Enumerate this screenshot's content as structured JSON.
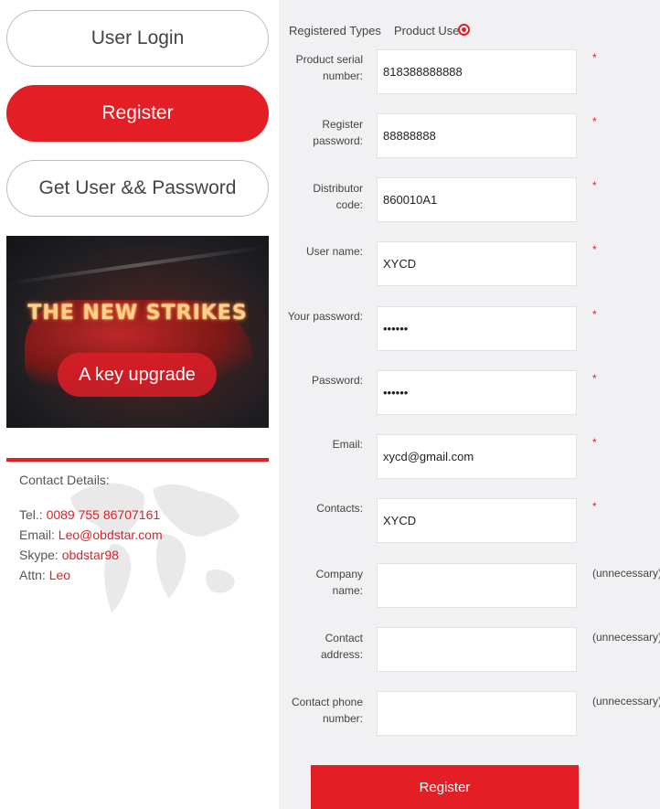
{
  "nav": {
    "user_login": "User Login",
    "register": "Register",
    "get_user_password": "Get User && Password"
  },
  "banner": {
    "headline": "THE NEW STRIKES",
    "tagline": "A key upgrade"
  },
  "contact": {
    "title": "Contact Details:",
    "tel_label": "Tel.:",
    "tel_value": "0089 755 86707161",
    "email_label": "Email:",
    "email_value": "Leo@obdstar.com",
    "skype_label": "Skype:",
    "skype_value": "obdstar98",
    "attn_label": "Attn:",
    "attn_value": "Leo"
  },
  "form": {
    "registered_types_label": "Registered Types",
    "product_user_label": "Product User",
    "product_user_selected": true,
    "fields": [
      {
        "label_line1": "Product serial",
        "label_line2": "number:",
        "value": "818388888888",
        "required_mark": "*",
        "optional_note": ""
      },
      {
        "label_line1": "Register",
        "label_line2": "password:",
        "value": "88888888",
        "required_mark": "*",
        "optional_note": ""
      },
      {
        "label_line1": "Distributor",
        "label_line2": "code:",
        "value": "860010A1",
        "required_mark": "*",
        "optional_note": ""
      },
      {
        "label_line1": "User name:",
        "label_line2": "",
        "value": "XYCD",
        "required_mark": "*",
        "optional_note": ""
      },
      {
        "label_line1": "Your password:",
        "label_line2": "",
        "value": "••••••",
        "required_mark": "*",
        "optional_note": ""
      },
      {
        "label_line1": "Password:",
        "label_line2": "",
        "value": "••••••",
        "required_mark": "*",
        "optional_note": ""
      },
      {
        "label_line1": "Email:",
        "label_line2": "",
        "value": "xycd@gmail.com",
        "required_mark": "*",
        "optional_note": ""
      },
      {
        "label_line1": "Contacts:",
        "label_line2": "",
        "value": "XYCD",
        "required_mark": "*",
        "optional_note": ""
      },
      {
        "label_line1": "Company",
        "label_line2": "name:",
        "value": "",
        "required_mark": "",
        "optional_note": "(unnecessary)"
      },
      {
        "label_line1": "Contact",
        "label_line2": "address:",
        "value": "",
        "required_mark": "",
        "optional_note": "(unnecessary)"
      },
      {
        "label_line1": "Contact phone",
        "label_line2": "number:",
        "value": "",
        "required_mark": "",
        "optional_note": "(unnecessary)"
      }
    ],
    "submit_label": "Register"
  },
  "colors": {
    "accent": "#e31e25",
    "right_panel_bg": "#f1f1f3"
  }
}
